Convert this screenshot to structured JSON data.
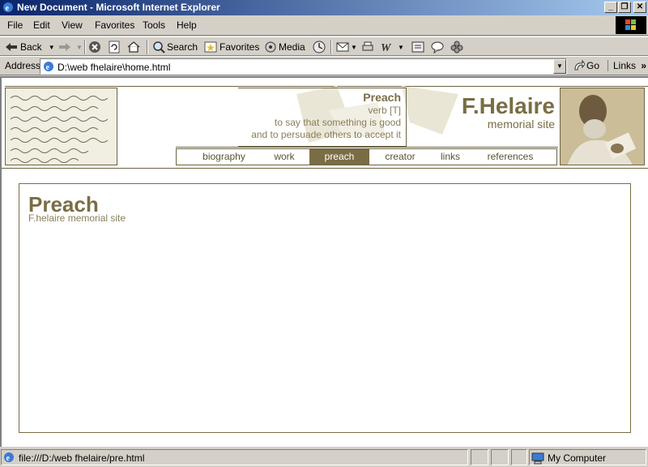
{
  "window": {
    "title": "New Document - Microsoft Internet Explorer",
    "minimize": "_",
    "restore": "❐",
    "close": "✕"
  },
  "menu": [
    {
      "label": "File"
    },
    {
      "label": "Edit"
    },
    {
      "label": "View"
    },
    {
      "label": "Favorites"
    },
    {
      "label": "Tools"
    },
    {
      "label": "Help"
    }
  ],
  "toolbar": {
    "back_label": "Back",
    "search_label": "Search",
    "favorites_label": "Favorites",
    "media_label": "Media"
  },
  "address": {
    "label": "Address",
    "value": "D:\\web fhelaire\\home.html",
    "go_label": "Go",
    "links_label": "Links"
  },
  "site": {
    "definition": {
      "word": "Preach",
      "pos": "verb [T]",
      "line1": "to say that something is good",
      "line2": "and to persuade others to accept it"
    },
    "brand_title": "F.Helaire",
    "brand_subtitle": "memorial site",
    "nav": [
      {
        "label": "biography",
        "active": false
      },
      {
        "label": "work",
        "active": false
      },
      {
        "label": "preach",
        "active": true
      },
      {
        "label": "creator",
        "active": false
      },
      {
        "label": "links",
        "active": false
      },
      {
        "label": "references",
        "active": false
      }
    ],
    "accent_color": "#7a6d45"
  },
  "main": {
    "heading": "Preach",
    "subheading": "F.helaire memorial site"
  },
  "status": {
    "text": "file:///D:/web fhelaire/pre.html",
    "zone": "My Computer"
  }
}
